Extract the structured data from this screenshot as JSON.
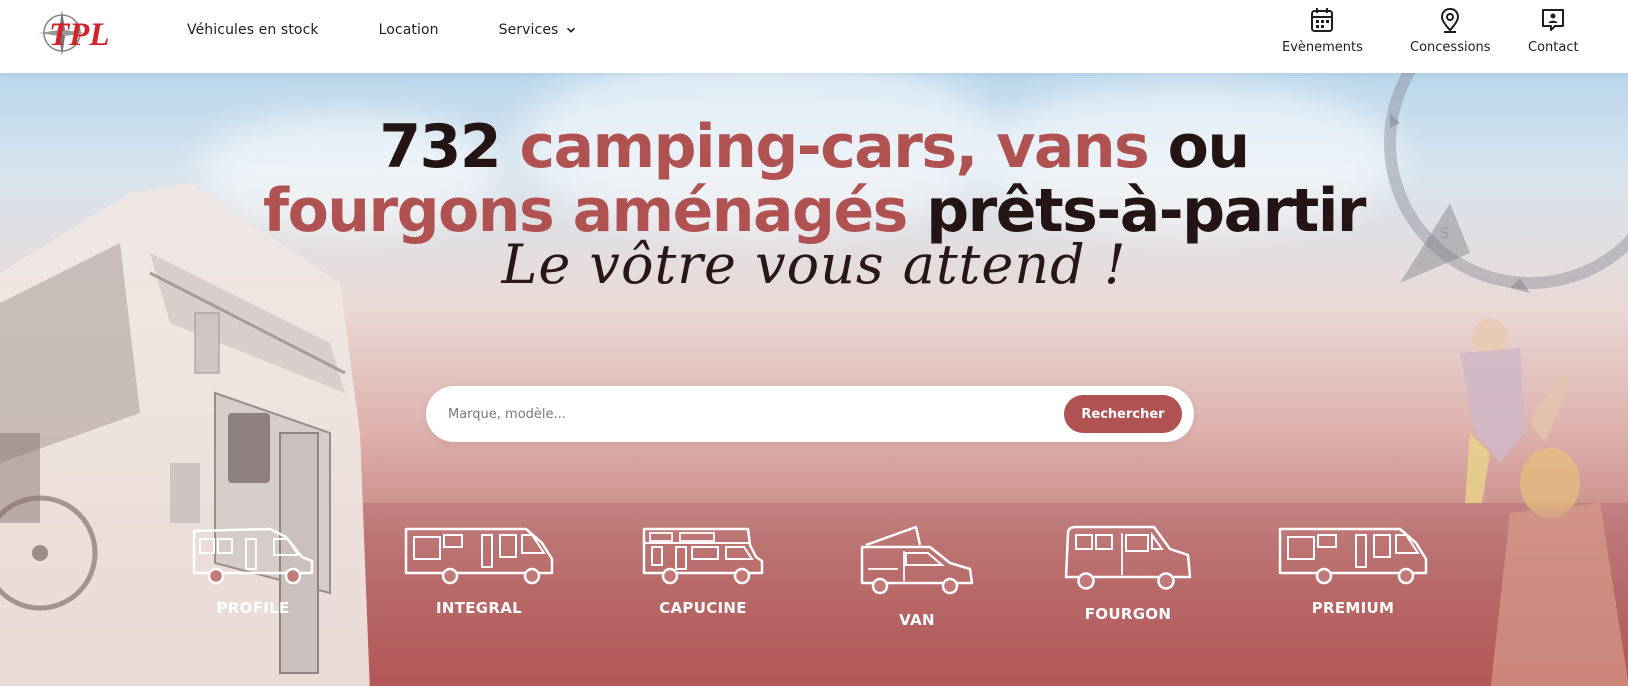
{
  "brand": {
    "logo_text": "TPL",
    "logo_color": "#d3232a"
  },
  "nav": [
    {
      "label": "Véhicules en stock"
    },
    {
      "label": "Location"
    },
    {
      "label": "Services",
      "has_dropdown": true
    }
  ],
  "utility": [
    {
      "label": "Evènements",
      "icon": "calendar-icon"
    },
    {
      "label": "Concessions",
      "icon": "location-pin-icon"
    },
    {
      "label": "Contact",
      "icon": "contact-card-icon"
    }
  ],
  "hero": {
    "line1_count": "732",
    "line1_accent": "camping-cars, vans",
    "line1_end": "ou",
    "line2_accent": "fourgons aménagés",
    "line2_end": "prêts-à-partir",
    "tagline": "Le vôtre vous attend !"
  },
  "search": {
    "placeholder": "Marque, modèle...",
    "button_label": "Rechercher"
  },
  "categories": [
    {
      "label": "PROFILE"
    },
    {
      "label": "INTEGRAL"
    },
    {
      "label": "CAPUCINE"
    },
    {
      "label": "VAN"
    },
    {
      "label": "FOURGON"
    },
    {
      "label": "PREMIUM"
    }
  ],
  "colors": {
    "accent": "#b05252",
    "dark_text": "#241414"
  }
}
